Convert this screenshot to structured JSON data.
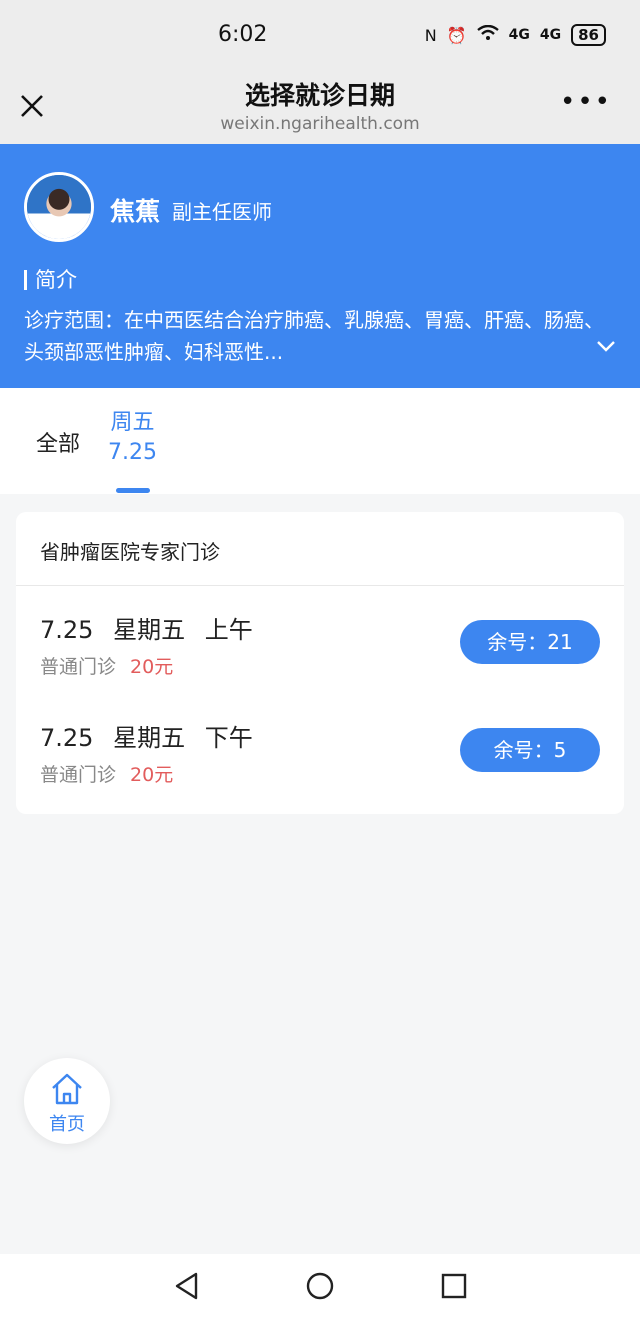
{
  "status_bar": {
    "time": "6:02",
    "signal_1": "4G",
    "signal_2": "4G",
    "battery": "86"
  },
  "nav": {
    "title": "选择就诊日期",
    "url": "weixin.ngarihealth.com",
    "more": "•••"
  },
  "doctor": {
    "name": "焦蕉",
    "title": "副主任医师",
    "intro_heading": "简介",
    "intro_text": "诊疗范围：在中西医结合治疗肺癌、乳腺癌、胃癌、肝癌、肠癌、头颈部恶性肿瘤、妇科恶性..."
  },
  "tabs": {
    "all": "全部",
    "fri_day": "周五",
    "fri_date": "7.25"
  },
  "clinic": {
    "name": "省肿瘤医院专家门诊",
    "slots": [
      {
        "date": "7.25",
        "weekday": "星期五",
        "period": "上午",
        "type": "普通门诊",
        "price": "20元",
        "remaining_label": "余号：21"
      },
      {
        "date": "7.25",
        "weekday": "星期五",
        "period": "下午",
        "type": "普通门诊",
        "price": "20元",
        "remaining_label": "余号：5"
      }
    ]
  },
  "home_button": {
    "label": "首页"
  },
  "colors": {
    "accent": "#3d86f0",
    "price": "#e25c5c"
  },
  "icons": [
    "close-icon",
    "more-icon",
    "chevron-down-icon",
    "home-icon",
    "back-icon",
    "home-circle-icon",
    "recents-icon"
  ]
}
